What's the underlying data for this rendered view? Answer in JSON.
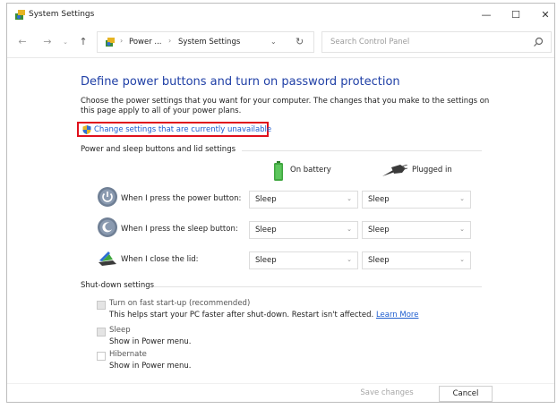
{
  "window": {
    "title": "System Settings",
    "controls": {
      "minimize": "—",
      "maximize": "☐",
      "close": "✕"
    }
  },
  "nav": {
    "back_icon": "←",
    "forward_icon": "→",
    "recent_icon": "⌄",
    "up_icon": "↑",
    "breadcrumb": [
      "Power ...",
      "System Settings"
    ],
    "breadcrumb_sep": "›",
    "address_dropdown_icon": "⌄",
    "refresh_icon": "↻",
    "search_placeholder": "Search Control Panel"
  },
  "main": {
    "heading": "Define power buttons and turn on password protection",
    "description": "Choose the power settings that you want for your computer. The changes that you make to the settings on this page apply to all of your power plans.",
    "change_link": "Change settings that are currently unavailable",
    "power_section": {
      "title": "Power and sleep buttons and lid settings",
      "columns": [
        "On battery",
        "Plugged in"
      ],
      "rows": [
        {
          "label": "When I press the power button:",
          "on_battery": "Sleep",
          "plugged_in": "Sleep",
          "icon": "power-button-icon"
        },
        {
          "label": "When I press the sleep button:",
          "on_battery": "Sleep",
          "plugged_in": "Sleep",
          "icon": "sleep-button-icon"
        },
        {
          "label": "When I close the lid:",
          "on_battery": "Sleep",
          "plugged_in": "Sleep",
          "icon": "laptop-lid-icon"
        }
      ]
    },
    "shutdown_section": {
      "title": "Shut-down settings",
      "items": [
        {
          "label": "Turn on fast start-up (recommended)",
          "desc": "This helps start your PC faster after shut-down. Restart isn't affected.",
          "link": "Learn More",
          "checked": true
        },
        {
          "label": "Sleep",
          "desc": "Show in Power menu.",
          "checked": true
        },
        {
          "label": "Hibernate",
          "desc": "Show in Power menu.",
          "checked": false
        }
      ]
    }
  },
  "footer": {
    "save": "Save changes",
    "cancel": "Cancel"
  },
  "colors": {
    "heading": "#1f3fa6",
    "link": "#1d5dcf",
    "highlight_border": "#e0101c"
  }
}
